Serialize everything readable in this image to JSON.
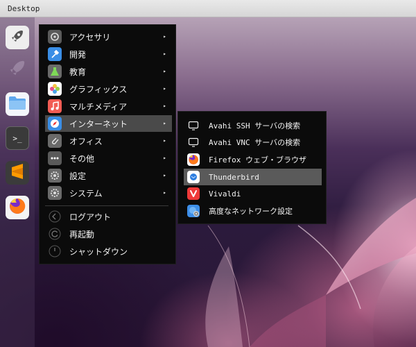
{
  "topbar": {
    "title": "Desktop"
  },
  "dock": {
    "items": [
      {
        "name": "launcher",
        "icon": "rocket-icon"
      },
      {
        "name": "launcher-ghost",
        "icon": "rocket-icon"
      },
      {
        "name": "files",
        "icon": "folder-icon"
      },
      {
        "name": "terminal",
        "icon": "terminal-icon",
        "glyph": ">_"
      },
      {
        "name": "sublime-text",
        "icon": "sublime-icon"
      },
      {
        "name": "firefox",
        "icon": "firefox-icon"
      }
    ]
  },
  "menu": {
    "items": [
      {
        "label": "アクセサリ",
        "icon": "accessories-icon",
        "color": "#5a5a5a",
        "arrow": "▸"
      },
      {
        "label": "開発",
        "icon": "development-icon",
        "color": "#3a8ee6",
        "arrow": "▸"
      },
      {
        "label": "教育",
        "icon": "education-icon",
        "color": "#6a6a6a",
        "arrow": "▸"
      },
      {
        "label": "グラフィックス",
        "icon": "graphics-icon",
        "color": "#f0a85a",
        "arrow": "▸"
      },
      {
        "label": "マルチメディア",
        "icon": "multimedia-icon",
        "color": "#f25c54",
        "arrow": "▸"
      },
      {
        "label": "インターネット",
        "icon": "internet-icon",
        "color": "#3a8ee6",
        "arrow": "▸",
        "active": true
      },
      {
        "label": "オフィス",
        "icon": "office-icon",
        "color": "#6a6a6a",
        "arrow": "▸"
      },
      {
        "label": "その他",
        "icon": "other-icon",
        "color": "#5a5a5a",
        "arrow": "▸"
      },
      {
        "label": "設定",
        "icon": "settings-icon",
        "color": "#6a6a6a",
        "arrow": "▸"
      },
      {
        "label": "システム",
        "icon": "system-icon",
        "color": "#6a6a6a",
        "arrow": "▸"
      }
    ],
    "power": [
      {
        "label": "ログアウト",
        "icon": "logout-icon"
      },
      {
        "label": "再起動",
        "icon": "restart-icon"
      },
      {
        "label": "シャットダウン",
        "icon": "shutdown-icon"
      }
    ]
  },
  "submenu": {
    "items": [
      {
        "label": "Avahi SSH サーバの検索",
        "icon": "monitor-icon"
      },
      {
        "label": "Avahi VNC サーバの検索",
        "icon": "monitor-icon"
      },
      {
        "label": "Firefox ウェブ・ブラウザ",
        "icon": "firefox-icon"
      },
      {
        "label": "Thunderbird",
        "icon": "thunderbird-icon",
        "active": true
      },
      {
        "label": "Vivaldi",
        "icon": "vivaldi-icon"
      },
      {
        "label": "高度なネットワーク設定",
        "icon": "network-settings-icon"
      }
    ]
  },
  "colors": {
    "menu_bg": "#0b0b0b",
    "highlight": "#4a4a4a",
    "submenu_highlight": "#5a5a5a",
    "topbar": "#e0e0e0"
  }
}
